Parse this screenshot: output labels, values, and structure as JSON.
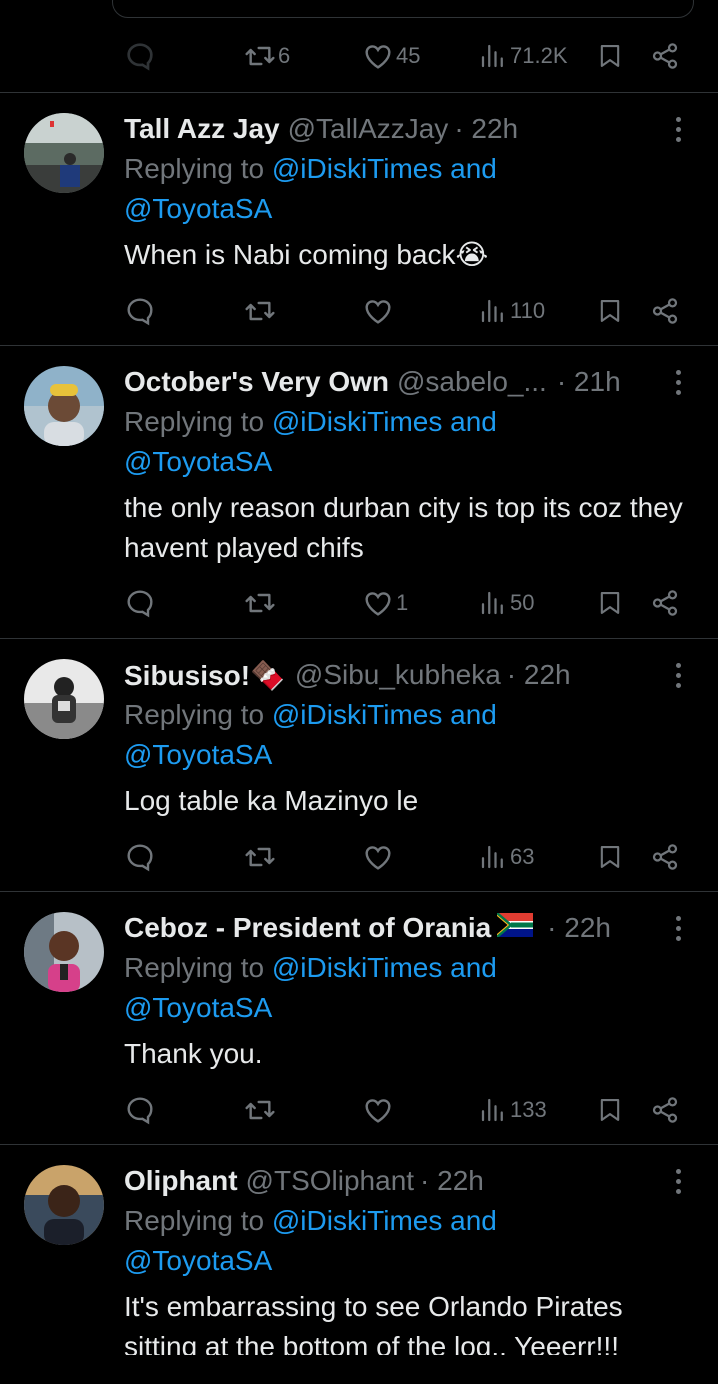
{
  "top_actions": {
    "reply": "",
    "retweet": "6",
    "like": "45",
    "views": "71.2K"
  },
  "replies": [
    {
      "name": "Tall Azz Jay",
      "handle": "@TallAzzJay",
      "time": "· 22h",
      "replying_prefix": "Replying to ",
      "mention1": "@iDiskiTimes and",
      "mention2": "@ToyotaSA",
      "text": "When is Nabi coming back😭",
      "actions": {
        "reply": "",
        "retweet": "",
        "like": "",
        "views": "110"
      }
    },
    {
      "name": "October's Very Own",
      "handle": "@sabelo_...",
      "time": "· 21h",
      "replying_prefix": "Replying to ",
      "mention1": "@iDiskiTimes and",
      "mention2": "@ToyotaSA",
      "text": "the only reason durban city is top its coz they havent played chifs",
      "actions": {
        "reply": "",
        "retweet": "",
        "like": "1",
        "views": "50"
      }
    },
    {
      "name": "Sibusiso!🍫",
      "handle": "@Sibu_kubheka",
      "time": "· 22h",
      "replying_prefix": "Replying to ",
      "mention1": "@iDiskiTimes and",
      "mention2": "@ToyotaSA",
      "text": "Log table ka Mazinyo le",
      "actions": {
        "reply": "",
        "retweet": "",
        "like": "",
        "views": "63"
      }
    },
    {
      "name": "Ceboz - President of Orania",
      "handle": "",
      "time": "· 22h",
      "replying_prefix": "Replying to ",
      "mention1": "@iDiskiTimes and",
      "mention2": "@ToyotaSA",
      "text": "Thank you.",
      "actions": {
        "reply": "",
        "retweet": "",
        "like": "",
        "views": "133"
      }
    },
    {
      "name": "Oliphant",
      "handle": "@TSOliphant",
      "time": "· 22h",
      "replying_prefix": "Replying to ",
      "mention1": "@iDiskiTimes and",
      "mention2": "@ToyotaSA",
      "text": "It's embarrassing to see Orlando Pirates sitting at the bottom of the log.. Yeeerr!!!",
      "actions": {
        "reply": "",
        "retweet": "",
        "like": "",
        "views": ""
      }
    }
  ],
  "colors": {
    "background": "#000000",
    "text": "#e7e9ea",
    "muted": "#71767b",
    "link": "#1d9bf0",
    "divider": "#2f3336"
  },
  "icons": [
    "reply-icon",
    "retweet-icon",
    "like-icon",
    "views-icon",
    "bookmark-icon",
    "share-icon",
    "more-options-icon",
    "south-africa-flag-icon"
  ]
}
